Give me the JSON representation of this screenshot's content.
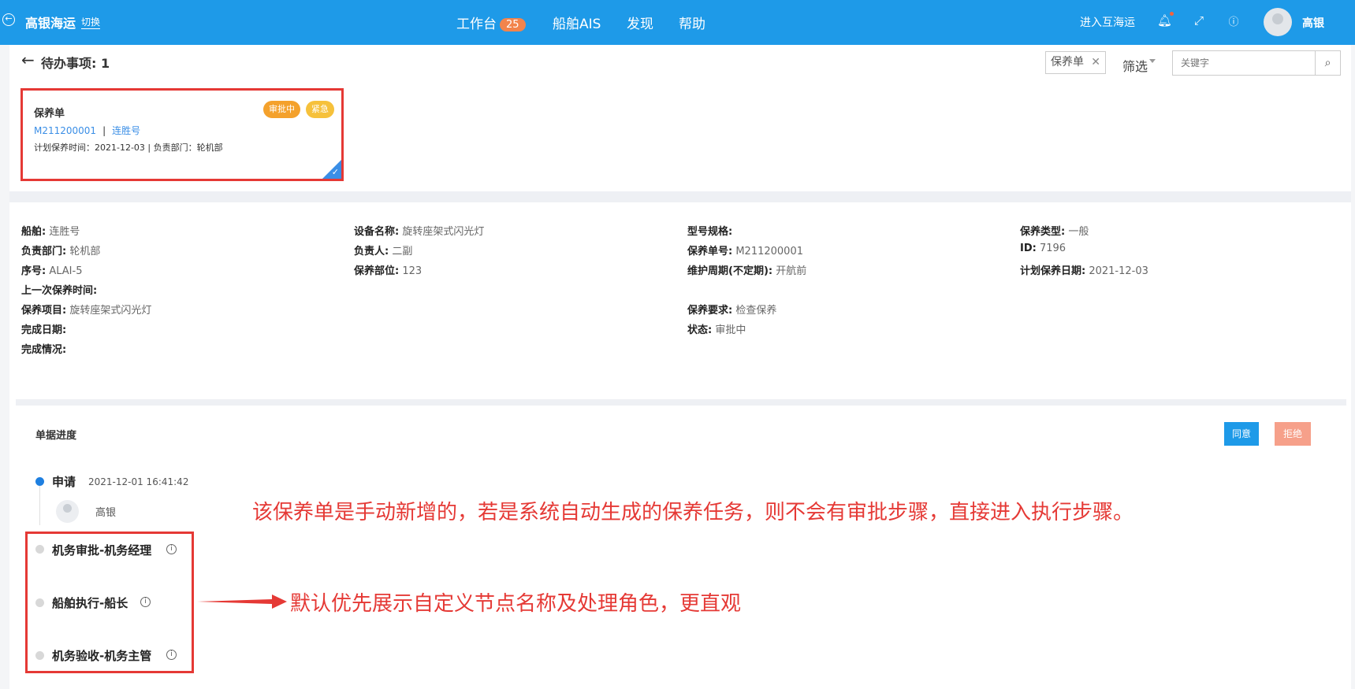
{
  "topbar": {
    "brand": "高银海运",
    "switch_label": "切换",
    "nav": [
      {
        "label": "工作台",
        "badge": "25"
      },
      {
        "label": "船舶AIS"
      },
      {
        "label": "发现"
      },
      {
        "label": "帮助"
      }
    ],
    "right_link": "进入互海运",
    "user_name": "高银",
    "icons": [
      "back-circle-icon",
      "bell-icon",
      "fullscreen-icon",
      "help-icon"
    ],
    "color": "#1e9ae8"
  },
  "todo": {
    "title": "待办事项: 1",
    "filter_tag": "保养单",
    "filter_label": "筛选",
    "search_placeholder": "关键字"
  },
  "card": {
    "title": "保养单",
    "order_no": "M211200001",
    "ship": "连胜号",
    "meta": "计划保养时间：2021-12-03 | 负责部门：轮机部",
    "badge_status": "审批中",
    "badge_priority": "紧急"
  },
  "details": {
    "col1": [
      {
        "label": "船舶:",
        "value": "连胜号"
      },
      {
        "label": "负责部门:",
        "value": "轮机部"
      },
      {
        "label": "序号:",
        "value": "ALAI-5"
      },
      {
        "label": "上一次保养时间:",
        "value": ""
      },
      {
        "label": "保养项目:",
        "value": "旋转座架式闪光灯"
      },
      {
        "label": "完成日期:",
        "value": ""
      },
      {
        "label": "完成情况:",
        "value": ""
      }
    ],
    "col2": [
      {
        "label": "设备名称:",
        "value": "旋转座架式闪光灯"
      },
      {
        "label": "负责人:",
        "value": "二副"
      },
      {
        "label": "保养部位:",
        "value": "123"
      }
    ],
    "col3": [
      {
        "label": "型号规格:",
        "value": ""
      },
      {
        "label": "保养单号:",
        "value": "M211200001"
      },
      {
        "label": "维护周期(不定期):",
        "value": "开航前"
      },
      {
        "label": "保养要求:",
        "value": "检查保养"
      },
      {
        "label": "状态:",
        "value": "审批中"
      }
    ],
    "col4": [
      {
        "label": "保养类型:",
        "value": "一般"
      },
      {
        "label": "ID:",
        "value": "7196"
      },
      {
        "label": "计划保养日期:",
        "value": "2021-12-03"
      }
    ]
  },
  "progress": {
    "title": "单据进度",
    "agree": "同意",
    "reject": "拒绝",
    "steps": [
      {
        "name": "申请",
        "time": "2021-12-01 16:41:42",
        "user": "高银"
      },
      {
        "name": "机务审批-机务经理"
      },
      {
        "name": "船舶执行-船长"
      },
      {
        "name": "机务验收-机务主管"
      }
    ]
  },
  "annotations": {
    "note1": "该保养单是手动新增的，若是系统自动生成的保养任务，则不会有审批步骤，直接进入执行步骤。",
    "note2": "默认优先展示自定义节点名称及处理角色，更直观"
  }
}
